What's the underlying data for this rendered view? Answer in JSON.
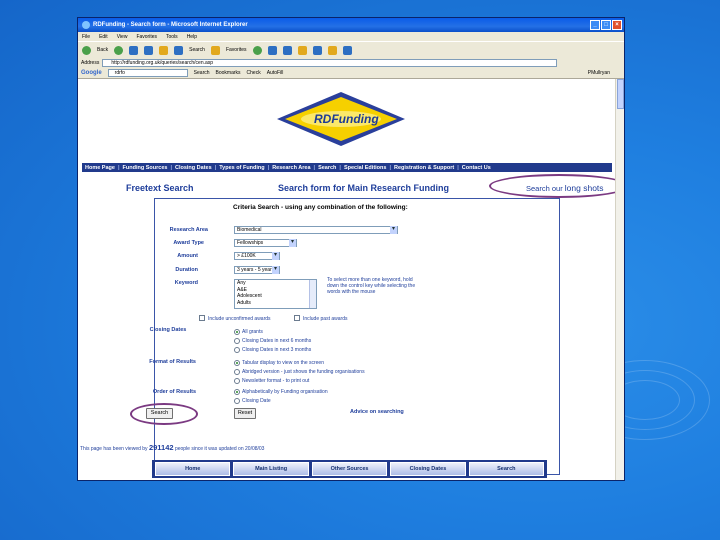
{
  "window": {
    "title": "RDFunding - Search form - Microsoft Internet Explorer"
  },
  "menu": [
    "File",
    "Edit",
    "View",
    "Favorites",
    "Tools",
    "Help"
  ],
  "toolbar": {
    "back": "Back",
    "search": "Search",
    "favorites": "Favorites"
  },
  "address": {
    "label": "Address",
    "url": "http://rdfunding.org.uk/queries/search/cen.asp"
  },
  "google": {
    "logo": "Google",
    "query": "rdrfo",
    "search": "Search",
    "bookmarks": "Bookmarks",
    "check": "Check",
    "autofill": "AutoFill",
    "profile": "PMullryan"
  },
  "site": {
    "logo": "RDFunding",
    "nav": [
      "Home Page",
      "Funding Sources",
      "Closing Dates",
      "Types of Funding",
      "Research Area",
      "Search",
      "Special Editions",
      "Registration & Support",
      "Contact Us"
    ],
    "freetext_title": "Freetext Search",
    "main_title": "Search form for Main Research Funding",
    "long_shots_prefix": "Search our",
    "long_shots_big": "long shots"
  },
  "form": {
    "heading": "Criteria Search - using any combination of the following:",
    "research_area_label": "Research Area",
    "research_area_value": "Biomedical",
    "award_type_label": "Award Type",
    "award_type_value": "Fellowships",
    "amount_label": "Amount",
    "amount_value": "> £100K",
    "duration_label": "Duration",
    "duration_value": "3 years - 5 years",
    "keyword_label": "Keyword",
    "keywords": [
      "Any",
      "A&E",
      "Adolescent",
      "Adults"
    ],
    "keyword_hint": "To select more than one keyword, hold down the control key while selecting the words with the mouse",
    "include_unconfirmed": "Include unconfirmed awards",
    "include_past": "Include past awards",
    "closing_dates_label": "Closing Dates",
    "closing_options": [
      "All grants",
      "Closing Dates in next 6 months",
      "Closing Dates in next 3 months"
    ],
    "format_label": "Format of Results",
    "format_options": [
      "Tabular display to view on the screen",
      "Abridged version - just shows the funding organisations",
      "Newsletter format - to print out"
    ],
    "order_label": "Order of Results",
    "order_options": [
      "Alphabetically by Funding organisation",
      "Closing Date"
    ],
    "search_button": "Search",
    "reset_button": "Reset",
    "advice_link": "Advice on searching"
  },
  "footer": {
    "counter_prefix": "This page has been viewed by",
    "counter_value": "291142",
    "counter_suffix": "people since it was updated on 20/08/03",
    "nav": [
      "Home",
      "Main Listing",
      "Other Sources",
      "Closing Dates",
      "Search"
    ]
  }
}
